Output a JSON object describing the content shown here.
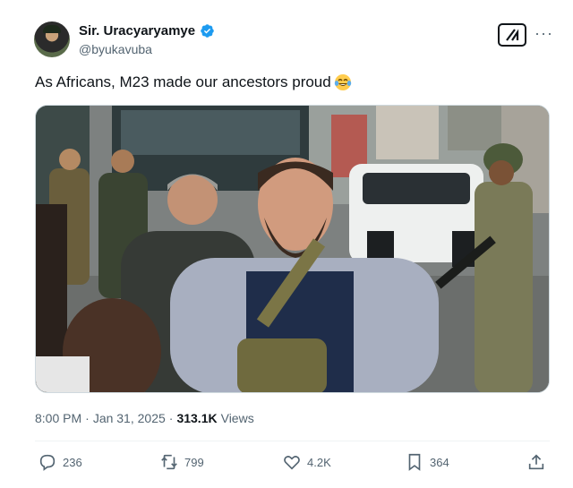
{
  "author": {
    "display_name": "Sir. Uracyaryamye",
    "handle": "@byukavuba",
    "verified": true
  },
  "tweet": {
    "text": "As Africans, M23 made our ancestors proud",
    "emoji": "face-with-tears-of-joy"
  },
  "meta": {
    "time": "8:00 PM",
    "date": "Jan 31, 2025",
    "separator": "·",
    "views_count": "313.1K",
    "views_label": "Views"
  },
  "actions": {
    "replies": "236",
    "reposts": "799",
    "likes": "4.2K",
    "bookmarks": "364"
  },
  "colors": {
    "verified": "#1d9bf0",
    "secondary_text": "#536471",
    "primary_text": "#0f1419"
  }
}
